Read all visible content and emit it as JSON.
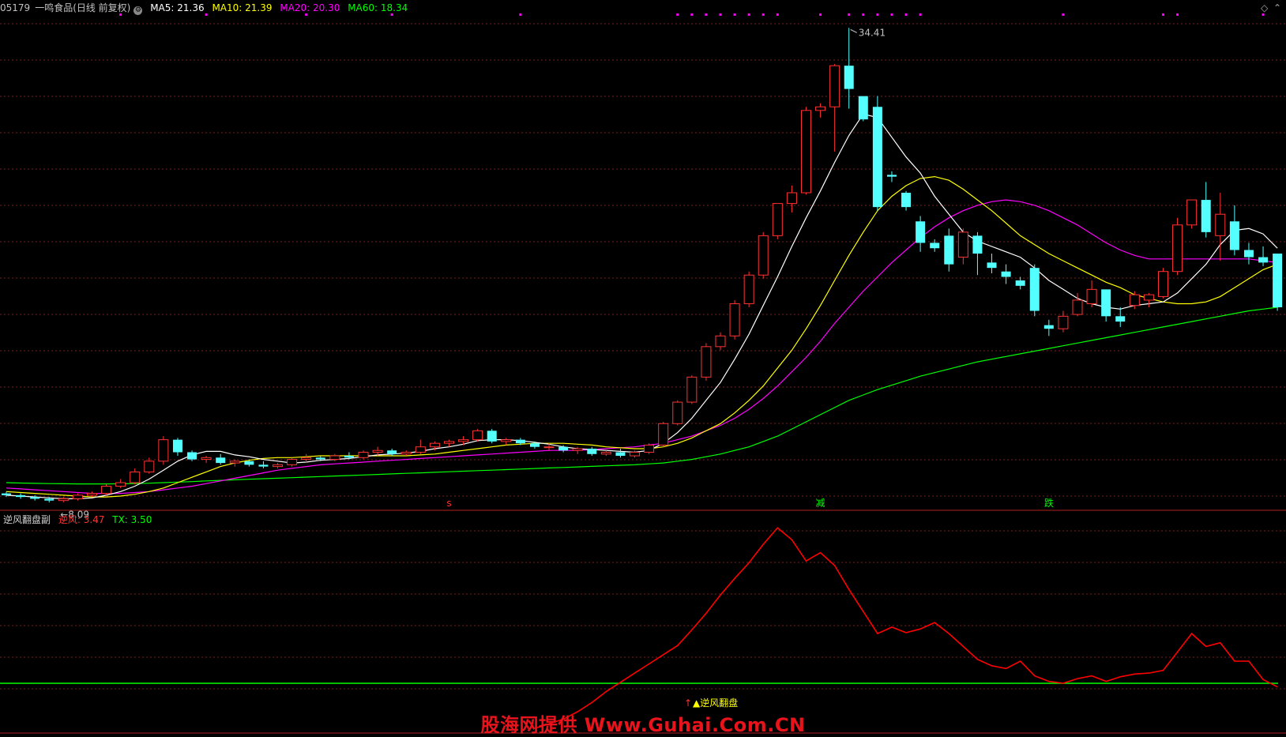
{
  "header": {
    "code": "05179",
    "name": "一鸣食品(日线 前复权)",
    "settings_icon": "gear-icon",
    "ma5_label": "MA5: 21.36",
    "ma10_label": "MA10: 21.39",
    "ma20_label": "MA20: 20.30",
    "ma60_label": "MA60: 18.34"
  },
  "indicator": {
    "title": "逆风翻盘副",
    "nifeng_label": "逆风: 3.47",
    "tx_label": "TX: 3.50",
    "signal_text": "▲逆风翻盘",
    "signal_arrow": "↑"
  },
  "annotations": {
    "high_price": "34.41",
    "low_price": "8.09",
    "marker_s": "s",
    "marker_jian": "减",
    "marker_die": "跌"
  },
  "watermark": "股海网提供 Www.Guhai.Com.CN",
  "colors": {
    "bg": "#000000",
    "up": "#ff3232",
    "down": "#54ffff",
    "ma5": "#ffffff",
    "ma10": "#ffff00",
    "ma20": "#ff00ff",
    "ma60": "#00ff00",
    "grid": "#7a1f1f",
    "nifeng": "#ff0000",
    "tx": "#00ff00"
  },
  "chart_data": {
    "type": "candlestick",
    "ylim": [
      7.5,
      35
    ],
    "high": 34.41,
    "low": 8.09,
    "candles": [
      [
        8.4,
        8.5,
        8.2,
        8.3
      ],
      [
        8.3,
        8.4,
        8.1,
        8.2
      ],
      [
        8.2,
        8.3,
        8.0,
        8.1
      ],
      [
        8.1,
        8.2,
        7.9,
        8.0
      ],
      [
        8.0,
        8.2,
        7.9,
        8.1
      ],
      [
        8.1,
        8.4,
        8.0,
        8.3
      ],
      [
        8.3,
        8.5,
        8.2,
        8.4
      ],
      [
        8.4,
        8.9,
        8.3,
        8.8
      ],
      [
        8.8,
        9.2,
        8.7,
        9.0
      ],
      [
        9.0,
        9.8,
        8.9,
        9.6
      ],
      [
        9.6,
        10.4,
        9.5,
        10.2
      ],
      [
        10.2,
        11.6,
        10.0,
        11.4
      ],
      [
        11.4,
        11.5,
        10.5,
        10.7
      ],
      [
        10.7,
        10.8,
        10.2,
        10.3
      ],
      [
        10.3,
        10.5,
        10.1,
        10.4
      ],
      [
        10.4,
        10.6,
        10.0,
        10.1
      ],
      [
        10.1,
        10.3,
        9.9,
        10.2
      ],
      [
        10.2,
        10.3,
        9.9,
        10.0
      ],
      [
        10.0,
        10.2,
        9.8,
        9.9
      ],
      [
        9.9,
        10.1,
        9.8,
        10.0
      ],
      [
        10.0,
        10.4,
        9.9,
        10.3
      ],
      [
        10.3,
        10.6,
        10.1,
        10.4
      ],
      [
        10.4,
        10.5,
        10.2,
        10.3
      ],
      [
        10.3,
        10.6,
        10.2,
        10.5
      ],
      [
        10.5,
        10.7,
        10.3,
        10.4
      ],
      [
        10.4,
        10.8,
        10.3,
        10.7
      ],
      [
        10.7,
        11.0,
        10.5,
        10.8
      ],
      [
        10.8,
        10.9,
        10.5,
        10.6
      ],
      [
        10.6,
        10.8,
        10.5,
        10.7
      ],
      [
        10.7,
        11.4,
        10.6,
        11.0
      ],
      [
        11.0,
        11.3,
        10.8,
        11.2
      ],
      [
        11.2,
        11.4,
        11.0,
        11.3
      ],
      [
        11.3,
        11.6,
        11.1,
        11.4
      ],
      [
        11.4,
        12.0,
        11.3,
        11.9
      ],
      [
        11.9,
        12.0,
        11.2,
        11.3
      ],
      [
        11.3,
        11.5,
        11.1,
        11.4
      ],
      [
        11.4,
        11.5,
        11.1,
        11.2
      ],
      [
        11.2,
        11.3,
        10.9,
        11.0
      ],
      [
        11.0,
        11.2,
        10.8,
        11.0
      ],
      [
        11.0,
        11.1,
        10.7,
        10.8
      ],
      [
        10.8,
        11.0,
        10.6,
        10.9
      ],
      [
        10.9,
        11.0,
        10.5,
        10.6
      ],
      [
        10.6,
        10.8,
        10.5,
        10.7
      ],
      [
        10.7,
        10.9,
        10.4,
        10.5
      ],
      [
        10.5,
        10.8,
        10.4,
        10.7
      ],
      [
        10.7,
        11.2,
        10.6,
        11.1
      ],
      [
        11.1,
        12.4,
        11.0,
        12.3
      ],
      [
        12.3,
        13.6,
        12.2,
        13.5
      ],
      [
        13.5,
        15.0,
        13.4,
        14.9
      ],
      [
        14.9,
        16.8,
        14.7,
        16.6
      ],
      [
        16.6,
        17.4,
        16.4,
        17.2
      ],
      [
        17.2,
        19.2,
        17.0,
        19.0
      ],
      [
        19.0,
        20.8,
        18.8,
        20.6
      ],
      [
        20.6,
        23.0,
        20.4,
        22.8
      ],
      [
        22.8,
        24.6,
        22.6,
        24.6
      ],
      [
        24.6,
        25.6,
        24.1,
        25.2
      ],
      [
        25.2,
        30.0,
        25.1,
        29.8
      ],
      [
        29.8,
        30.2,
        29.4,
        30.0
      ],
      [
        30.0,
        32.4,
        27.5,
        32.3
      ],
      [
        32.3,
        34.41,
        29.9,
        31.0
      ],
      [
        30.6,
        29.6,
        29.2,
        29.3
      ],
      [
        30.0,
        30.6,
        24.2,
        24.4
      ],
      [
        26.2,
        26.4,
        25.8,
        26.1
      ],
      [
        25.2,
        25.3,
        24.2,
        24.4
      ],
      [
        23.6,
        23.9,
        21.9,
        22.4
      ],
      [
        22.4,
        22.6,
        21.9,
        22.1
      ],
      [
        22.8,
        23.2,
        20.8,
        21.2
      ],
      [
        21.6,
        23.2,
        21.2,
        23.0
      ],
      [
        22.8,
        23.0,
        20.6,
        21.8
      ],
      [
        21.3,
        21.8,
        20.7,
        21.0
      ],
      [
        20.8,
        21.2,
        20.1,
        20.5
      ],
      [
        20.3,
        20.5,
        19.8,
        20.0
      ],
      [
        21.0,
        21.2,
        18.3,
        18.6
      ],
      [
        17.8,
        18.1,
        17.2,
        17.6
      ],
      [
        17.6,
        18.6,
        17.4,
        18.3
      ],
      [
        18.4,
        19.6,
        18.3,
        19.2
      ],
      [
        19.0,
        20.3,
        18.8,
        19.8
      ],
      [
        19.8,
        19.8,
        18.0,
        18.3
      ],
      [
        18.3,
        18.8,
        17.7,
        18.0
      ],
      [
        18.9,
        19.7,
        18.7,
        19.5
      ],
      [
        19.2,
        19.6,
        18.8,
        19.5
      ],
      [
        19.4,
        21.0,
        19.3,
        20.8
      ],
      [
        20.8,
        23.8,
        20.6,
        23.4
      ],
      [
        23.4,
        24.8,
        23.2,
        24.8
      ],
      [
        24.8,
        25.8,
        22.7,
        23.0
      ],
      [
        22.8,
        25.2,
        21.4,
        24.0
      ],
      [
        23.6,
        24.5,
        21.7,
        22.0
      ],
      [
        22.0,
        22.4,
        21.2,
        21.6
      ],
      [
        21.6,
        22.2,
        21.1,
        21.3
      ],
      [
        21.8,
        21.8,
        18.6,
        18.8
      ]
    ],
    "ma5": [
      8.3,
      8.25,
      8.2,
      8.15,
      8.1,
      8.1,
      8.15,
      8.3,
      8.5,
      8.8,
      9.2,
      9.7,
      10.2,
      10.55,
      10.75,
      10.75,
      10.55,
      10.45,
      10.3,
      10.2,
      10.1,
      10.15,
      10.25,
      10.3,
      10.35,
      10.45,
      10.55,
      10.6,
      10.65,
      10.75,
      10.9,
      11.0,
      11.15,
      11.35,
      11.4,
      11.4,
      11.35,
      11.25,
      11.15,
      11.0,
      10.9,
      10.85,
      10.8,
      10.75,
      10.7,
      10.8,
      11.2,
      11.8,
      12.6,
      13.6,
      14.6,
      15.9,
      17.3,
      18.9,
      20.5,
      22.2,
      23.8,
      25.3,
      26.9,
      28.4,
      29.6,
      29.4,
      28.3,
      27.2,
      26.3,
      25.0,
      24.0,
      23.0,
      22.5,
      22.2,
      21.9,
      21.6,
      21.0,
      20.3,
      19.8,
      19.3,
      19.0,
      18.8,
      18.7,
      18.9,
      19.0,
      19.1,
      19.6,
      20.4,
      21.2,
      22.3,
      23.1,
      23.2,
      22.9,
      22.1
    ],
    "ma10": [
      8.5,
      8.45,
      8.4,
      8.35,
      8.3,
      8.25,
      8.2,
      8.2,
      8.25,
      8.35,
      8.5,
      8.7,
      9.0,
      9.3,
      9.6,
      9.9,
      10.1,
      10.25,
      10.35,
      10.4,
      10.4,
      10.45,
      10.5,
      10.5,
      10.5,
      10.5,
      10.5,
      10.5,
      10.5,
      10.55,
      10.6,
      10.7,
      10.8,
      10.9,
      11.0,
      11.1,
      11.15,
      11.2,
      11.2,
      11.2,
      11.15,
      11.1,
      11.0,
      10.95,
      10.9,
      10.9,
      11.0,
      11.2,
      11.5,
      11.9,
      12.3,
      12.9,
      13.6,
      14.4,
      15.4,
      16.4,
      17.6,
      18.9,
      20.3,
      21.7,
      23.0,
      24.2,
      25.0,
      25.6,
      26.0,
      26.1,
      25.9,
      25.4,
      24.8,
      24.2,
      23.5,
      22.8,
      22.3,
      21.8,
      21.4,
      21.0,
      20.6,
      20.2,
      19.9,
      19.5,
      19.3,
      19.1,
      19.0,
      19.0,
      19.1,
      19.4,
      19.9,
      20.4,
      20.9,
      21.2
    ],
    "ma20": [
      8.7,
      8.65,
      8.6,
      8.55,
      8.5,
      8.45,
      8.4,
      8.4,
      8.4,
      8.45,
      8.5,
      8.6,
      8.7,
      8.8,
      8.95,
      9.1,
      9.25,
      9.4,
      9.55,
      9.7,
      9.8,
      9.9,
      10.0,
      10.05,
      10.1,
      10.15,
      10.2,
      10.25,
      10.3,
      10.35,
      10.4,
      10.45,
      10.5,
      10.55,
      10.6,
      10.65,
      10.7,
      10.75,
      10.8,
      10.8,
      10.8,
      10.85,
      10.9,
      10.95,
      11.0,
      11.1,
      11.2,
      11.4,
      11.6,
      11.9,
      12.2,
      12.6,
      13.1,
      13.7,
      14.4,
      15.2,
      16.0,
      16.9,
      17.9,
      18.8,
      19.7,
      20.5,
      21.3,
      22.0,
      22.7,
      23.3,
      23.8,
      24.2,
      24.5,
      24.7,
      24.8,
      24.7,
      24.5,
      24.2,
      23.8,
      23.4,
      22.9,
      22.4,
      22.0,
      21.7,
      21.5,
      21.5,
      21.5,
      21.5,
      21.5,
      21.5,
      21.5,
      21.5,
      21.4,
      21.3
    ],
    "ma60": [
      9.0,
      8.98,
      8.96,
      8.95,
      8.94,
      8.93,
      8.93,
      8.93,
      8.94,
      8.95,
      8.97,
      9.0,
      9.03,
      9.06,
      9.1,
      9.13,
      9.16,
      9.19,
      9.22,
      9.25,
      9.28,
      9.31,
      9.34,
      9.37,
      9.4,
      9.43,
      9.46,
      9.49,
      9.52,
      9.55,
      9.58,
      9.61,
      9.64,
      9.67,
      9.7,
      9.73,
      9.76,
      9.79,
      9.82,
      9.85,
      9.88,
      9.91,
      9.94,
      9.97,
      10.0,
      10.05,
      10.1,
      10.2,
      10.3,
      10.45,
      10.6,
      10.8,
      11.0,
      11.3,
      11.6,
      12.0,
      12.4,
      12.8,
      13.2,
      13.6,
      13.9,
      14.2,
      14.45,
      14.7,
      14.95,
      15.15,
      15.35,
      15.55,
      15.75,
      15.9,
      16.05,
      16.2,
      16.35,
      16.5,
      16.65,
      16.8,
      16.95,
      17.1,
      17.25,
      17.4,
      17.55,
      17.7,
      17.85,
      18.0,
      18.15,
      18.3,
      18.45,
      18.6,
      18.7,
      18.8
    ],
    "indicator": {
      "ylim": [
        -0.5,
        22
      ],
      "nifeng": [
        -0.5,
        0.0,
        0.5,
        1.3,
        2.3,
        3.5,
        4.5,
        5.5,
        6.5,
        7.5,
        8.5,
        10.2,
        12.0,
        14.0,
        15.8,
        17.5,
        19.5,
        21.3,
        20.0,
        17.7,
        18.6,
        17.2,
        14.6,
        12.2,
        9.8,
        10.5,
        9.9,
        10.3,
        11.0,
        9.8,
        8.4,
        7.0,
        6.3,
        6.0,
        6.8,
        5.2,
        4.6,
        4.4,
        4.9,
        5.2,
        4.6,
        5.1,
        5.4,
        5.5,
        5.8,
        7.8,
        9.8,
        8.4,
        8.8,
        6.8,
        6.8,
        4.8,
        4.0
      ],
      "tx": 4.4,
      "x_start_index": 37
    },
    "signals": [
      {
        "text": "s",
        "index": 31,
        "color": "#ff3232"
      },
      {
        "text": "减",
        "index": 57,
        "color": "#00ff00"
      },
      {
        "text": "跌",
        "index": 73,
        "color": "#00ff00"
      }
    ],
    "top_dot_indices": [
      8,
      14,
      21,
      27,
      36,
      47,
      48,
      49,
      50,
      51,
      52,
      53,
      54,
      57,
      59,
      60,
      61,
      62,
      63,
      64,
      74,
      81,
      82,
      88
    ]
  }
}
